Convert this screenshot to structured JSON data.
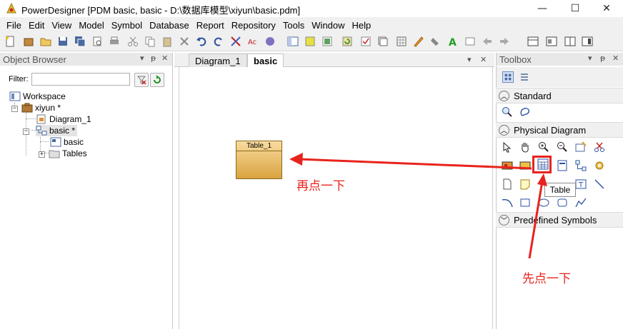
{
  "window": {
    "title": "PowerDesigner [PDM basic, basic - D:\\数据库模型\\xiyun\\basic.pdm]",
    "minimize": "—",
    "maximize": "☐",
    "close": "✕"
  },
  "menu": {
    "items": [
      "File",
      "Edit",
      "View",
      "Model",
      "Symbol",
      "Database",
      "Report",
      "Repository",
      "Tools",
      "Window",
      "Help"
    ]
  },
  "object_browser": {
    "title": "Object Browser",
    "controls": [
      "▾",
      "ᵽ",
      "✕"
    ],
    "filter_label": "Filter:",
    "filter_value": "",
    "tree": {
      "workspace": "Workspace",
      "project": "xiyun *",
      "diagram": "Diagram_1",
      "model": "basic *",
      "model_diagram": "basic",
      "tables": "Tables"
    }
  },
  "diagram": {
    "tabs": [
      "Diagram_1",
      "basic"
    ],
    "active_tab": "basic",
    "tab_controls": [
      "▾",
      "✕"
    ],
    "entity": {
      "name": "Table_1"
    }
  },
  "toolbox": {
    "title": "Toolbox",
    "controls": [
      "▾",
      "ᵽ",
      "✕"
    ],
    "sections": [
      "Standard",
      "Physical Diagram",
      "Predefined Symbols"
    ],
    "tooltip": "Table"
  },
  "annotations": {
    "first": "先点一下",
    "second": "再点一下",
    "color": "#e8231d"
  },
  "icons": {
    "app": "powerdesigner-icon",
    "workspace": "workspace-icon",
    "project": "project-icon",
    "diagram": "diagram-icon",
    "model": "model-icon",
    "folder": "folder-icon"
  }
}
